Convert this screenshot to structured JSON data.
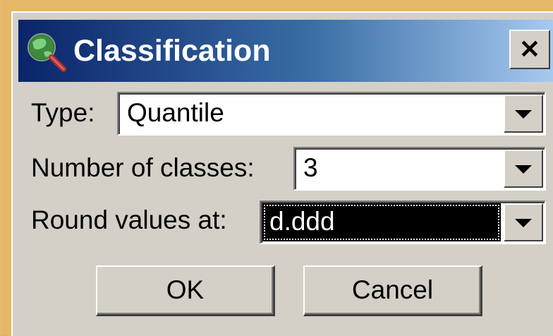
{
  "dialog": {
    "title": "Classification",
    "title_icon": "globe-magnifier-icon",
    "close_symbol": "✕",
    "colors": {
      "titlebar_start": "#0a246a",
      "titlebar_end": "#a6caf0",
      "face": "#d4d0c8",
      "selection": "#000000"
    }
  },
  "fields": {
    "type": {
      "label": "Type:",
      "value": "Quantile"
    },
    "num_classes": {
      "label": "Number of classes:",
      "value": "3"
    },
    "round_values": {
      "label": "Round values at:",
      "value": "d.ddd"
    }
  },
  "buttons": {
    "ok_label": "OK",
    "cancel_label": "Cancel"
  }
}
